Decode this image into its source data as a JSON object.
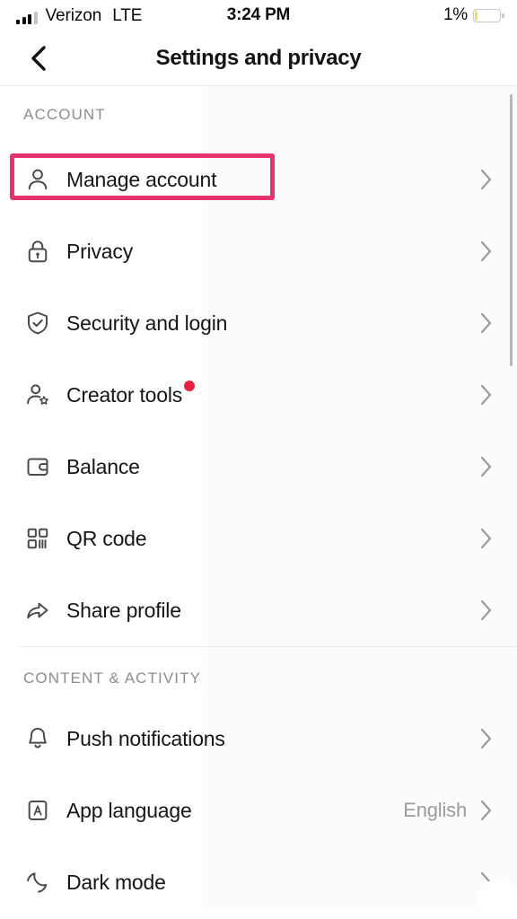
{
  "status_bar": {
    "carrier": "Verizon",
    "network": "LTE",
    "time": "3:24 PM",
    "battery_percent": "1%",
    "battery_level": 1,
    "battery_low_power_color": "#f3dd6d",
    "signal_bars_filled": 3,
    "signal_bars_total": 4
  },
  "nav": {
    "title": "Settings and privacy",
    "back_icon": "chevron-left-icon"
  },
  "highlight": {
    "color": "#e8326b",
    "target": "Manage account"
  },
  "sections": [
    {
      "header": "ACCOUNT",
      "rows": [
        {
          "label": "Manage account",
          "icon": "person-icon",
          "value": "",
          "badge": false,
          "chevron": "chevron-right-icon"
        },
        {
          "label": "Privacy",
          "icon": "lock-icon",
          "value": "",
          "badge": false,
          "chevron": "chevron-right-icon"
        },
        {
          "label": "Security and login",
          "icon": "shield-check-icon",
          "value": "",
          "badge": false,
          "chevron": "chevron-right-icon"
        },
        {
          "label": "Creator tools",
          "icon": "person-star-icon",
          "value": "",
          "badge": true,
          "chevron": "chevron-right-icon"
        },
        {
          "label": "Balance",
          "icon": "wallet-icon",
          "value": "",
          "badge": false,
          "chevron": "chevron-right-icon"
        },
        {
          "label": "QR code",
          "icon": "qr-code-icon",
          "value": "",
          "badge": false,
          "chevron": "chevron-right-icon"
        },
        {
          "label": "Share profile",
          "icon": "share-arrow-icon",
          "value": "",
          "badge": false,
          "chevron": "chevron-right-icon"
        }
      ]
    },
    {
      "header": "CONTENT & ACTIVITY",
      "rows": [
        {
          "label": "Push notifications",
          "icon": "bell-icon",
          "value": "",
          "badge": false,
          "chevron": "chevron-right-icon"
        },
        {
          "label": "App language",
          "icon": "language-a-icon",
          "value": "English",
          "badge": false,
          "chevron": "chevron-right-icon"
        },
        {
          "label": "Dark mode",
          "icon": "moon-icon",
          "value": "",
          "badge": false,
          "chevron": "chevron-right-icon"
        }
      ]
    }
  ],
  "badge": {
    "color": "#e8233f"
  },
  "scrollbar": {
    "color": "#b8b8bc"
  }
}
